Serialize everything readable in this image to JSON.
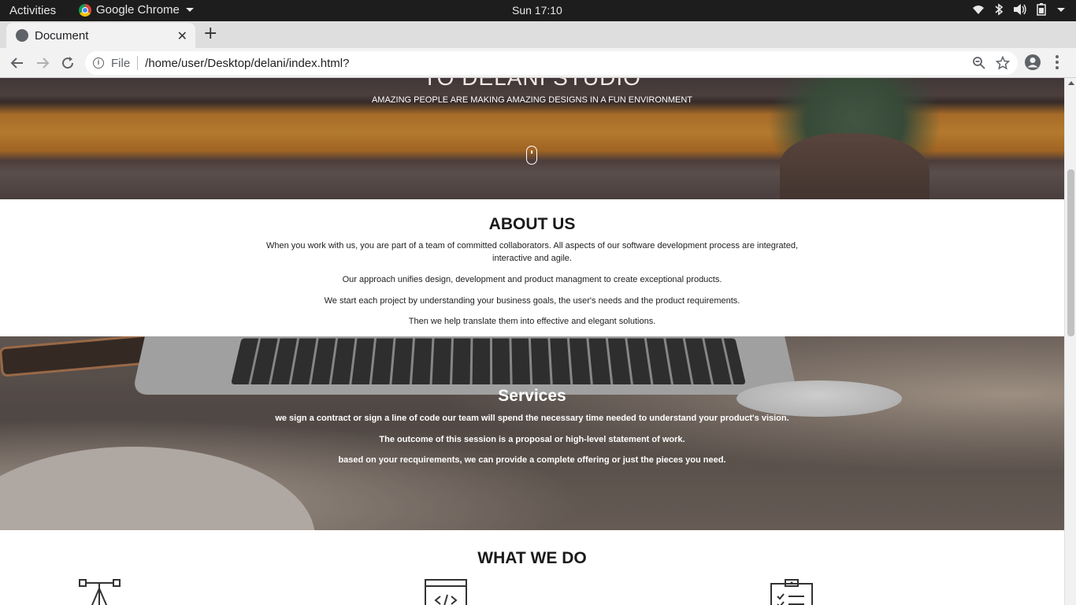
{
  "system_bar": {
    "activities": "Activities",
    "app_name": "Google Chrome",
    "clock": "Sun 17:10"
  },
  "browser": {
    "tab_title": "Document",
    "url_scheme": "File",
    "url": "/home/user/Desktop/delani/index.html?"
  },
  "hero": {
    "title": "TO DELANI STUDIO",
    "subtitle": "AMAZING PEOPLE ARE MAKING AMAZING DESIGNS IN A FUN ENVIRONMENT"
  },
  "about": {
    "heading": "ABOUT US",
    "paragraphs": [
      "When you work with us, you are part of a team of committed collaborators. All aspects of our software development process are integrated, interactive and agile.",
      "Our approach unifies design, development and product managment to create exceptional products.",
      "We start each project by understanding your business goals, the user's needs and the product requirements.",
      "Then we help translate them into effective and elegant solutions."
    ]
  },
  "services": {
    "heading": "Services",
    "paragraphs": [
      "we sign a contract or sign a line of code our team will spend the necessary time needed to understand your product's vision.",
      "The outcome of this session is a proposal or high-level statement of work.",
      "based on your recquirements, we can provide a complete offering or just the pieces you need."
    ]
  },
  "what_we_do": {
    "heading": "WHAT WE DO",
    "icons": [
      "design-easel-icon",
      "code-window-icon",
      "clipboard-checklist-icon"
    ]
  }
}
